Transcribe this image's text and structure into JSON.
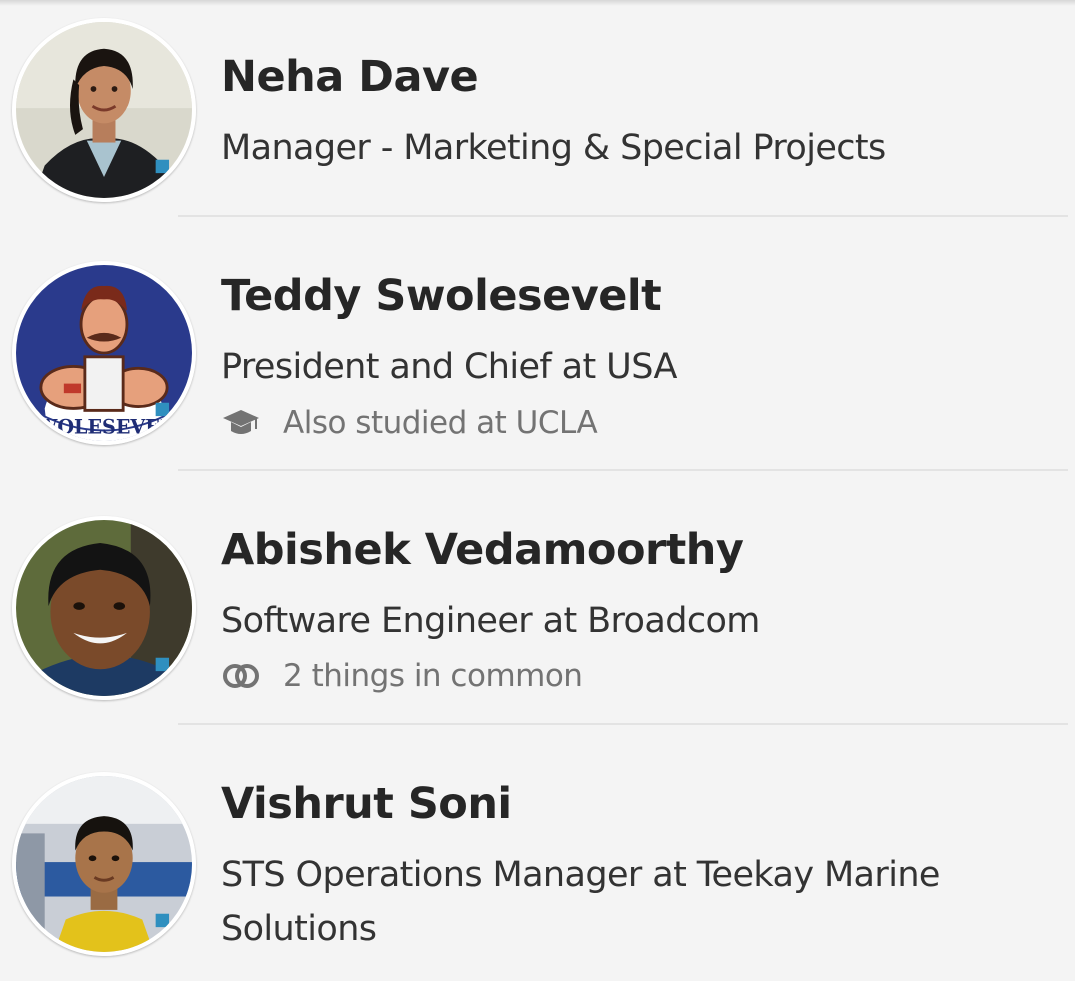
{
  "people": [
    {
      "name": "Neha Dave",
      "headline": "Manager - Marketing & Special Projects",
      "avatar": "person-photo"
    },
    {
      "name": "Teddy Swolesevelt",
      "headline": "President and Chief at USA",
      "meta_icon": "graduation-cap-icon",
      "meta_text": "Also studied at UCLA",
      "avatar": "cartoon-logo",
      "avatar_text": "SWOLESEVELT"
    },
    {
      "name": "Abishek Vedamoorthy",
      "headline": "Software Engineer at Broadcom",
      "meta_icon": "connections-icon",
      "meta_text": "2 things in common",
      "avatar": "person-photo"
    },
    {
      "name": "Vishrut Soni",
      "headline": "STS Operations Manager at Teekay Marine Solutions",
      "avatar": "person-photo"
    }
  ],
  "colors": {
    "background": "#f4f4f4",
    "name_text": "#262626",
    "headline_text": "#333333",
    "meta_text": "#737373",
    "divider": "#e3e3e3"
  }
}
